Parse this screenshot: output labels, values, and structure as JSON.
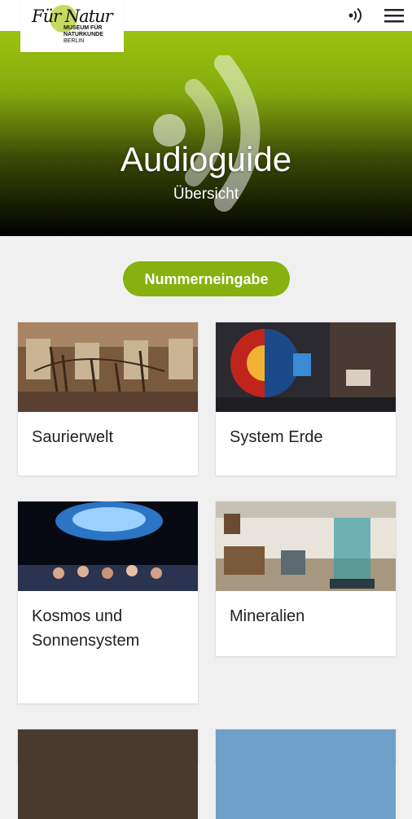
{
  "logo": {
    "script_text": "Für Natur",
    "line1": "MUSEUM FÜR",
    "line2": "NATURKUNDE",
    "line3": "BERLIN"
  },
  "hero": {
    "title": "Audioguide",
    "subtitle": "Übersicht"
  },
  "number_button_label": "Nummerneingabe",
  "cards": [
    {
      "label": "Saurierwelt"
    },
    {
      "label": "System Erde"
    },
    {
      "label": "Kosmos und Sonnensystem"
    },
    {
      "label": "Mineralien"
    }
  ],
  "colors": {
    "accent": "#86b10f",
    "hero_top": "#9ac40f",
    "background": "#f0f0f0"
  },
  "icons": [
    "audio-icon",
    "menu-icon"
  ]
}
